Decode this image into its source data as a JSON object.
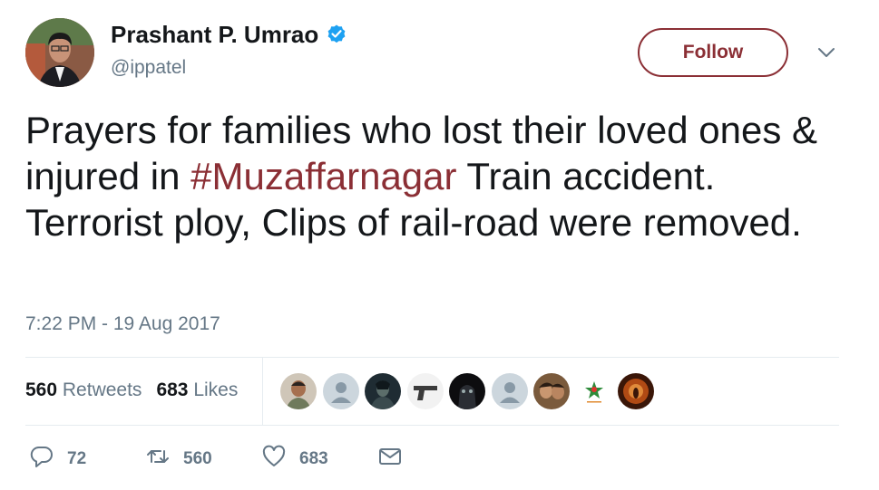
{
  "author": {
    "name": "Prashant P. Umrao",
    "handle": "@ippatel",
    "verified": true
  },
  "follow_button": {
    "label": "Follow"
  },
  "tweet": {
    "text_before": "Prayers for families who lost their loved ones & injured in ",
    "hashtag": "#Muzaffarnagar",
    "text_after": " Train accident. Terrorist ploy, Clips of rail-road were removed.",
    "timestamp": "7:22 PM - 19 Aug 2017"
  },
  "stats": {
    "retweets_count": "560",
    "retweets_label": "Retweets",
    "likes_count": "683",
    "likes_label": "Likes"
  },
  "actions": {
    "reply_count": "72",
    "retweet_count": "560",
    "like_count": "683"
  },
  "likers": [
    "liker-photo",
    "default-avatar",
    "liker-photo-dark",
    "gun-image",
    "liker-photo-black",
    "default-avatar",
    "liker-photo-couple",
    "logo",
    "liker-photo-orange"
  ],
  "colors": {
    "accent": "#8b2f35",
    "verified": "#1da1f2",
    "muted": "#657786",
    "text": "#14171a"
  }
}
